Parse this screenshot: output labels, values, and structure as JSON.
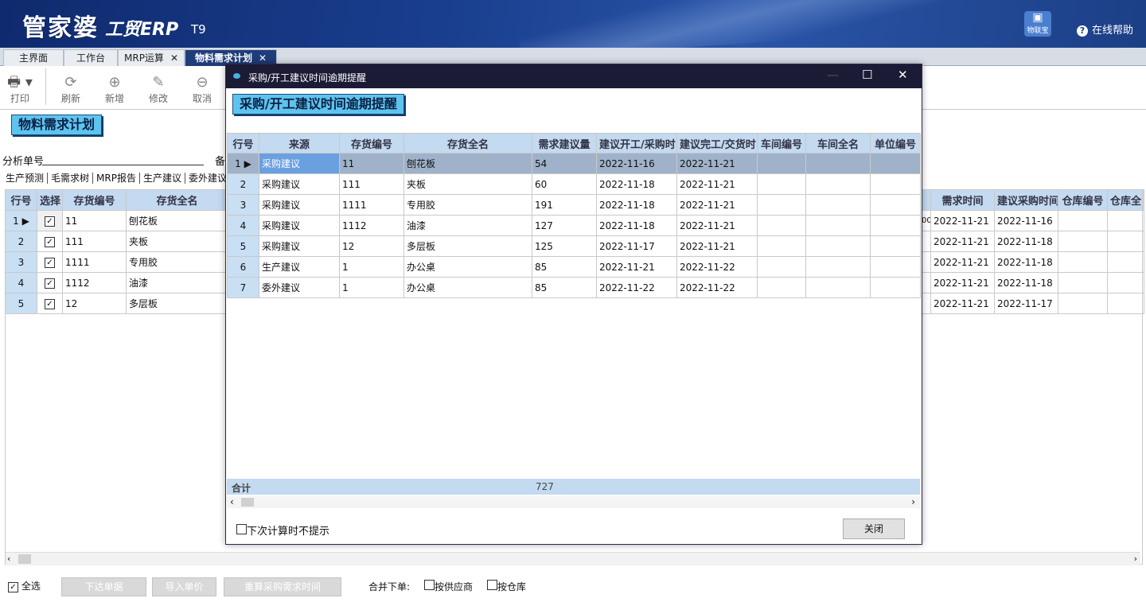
{
  "header": {
    "logo_text": "管家婆",
    "logo_sub": "工贸ERP",
    "logo_version": "T9",
    "iot_label": "物联宝",
    "help_label": "在线帮助"
  },
  "tabs": [
    {
      "label": "主界面"
    },
    {
      "label": "工作台"
    },
    {
      "label": "MRP运算"
    },
    {
      "label": "物料需求计划"
    }
  ],
  "toolbar": {
    "print": "打印",
    "refresh": "刷新",
    "add": "新增",
    "edit": "修改",
    "cancel": "取消"
  },
  "page": {
    "title": "物料需求计划",
    "analysis_label": "分析单号",
    "remark_label": "备",
    "subtabs": [
      "生产预测",
      "毛需求树",
      "MRP报告",
      "生产建议",
      "委外建议"
    ]
  },
  "main_grid": {
    "left_headers": [
      "行号",
      "选择",
      "存货编号",
      "存货全名"
    ],
    "right_headers": [
      "需求时间",
      "建议采购时间",
      "仓库编号",
      "仓库全"
    ],
    "rows": [
      {
        "no": "1",
        "code": "11",
        "name": "刨花板",
        "trail": "00",
        "need": "2022-11-21",
        "buy": "2022-11-16"
      },
      {
        "no": "2",
        "code": "111",
        "name": "夹板",
        "trail": "",
        "need": "2022-11-21",
        "buy": "2022-11-18"
      },
      {
        "no": "3",
        "code": "1111",
        "name": "专用胶",
        "trail": "",
        "need": "2022-11-21",
        "buy": "2022-11-18"
      },
      {
        "no": "4",
        "code": "1112",
        "name": "油漆",
        "trail": "",
        "need": "2022-11-21",
        "buy": "2022-11-18"
      },
      {
        "no": "5",
        "code": "12",
        "name": "多层板",
        "trail": "",
        "need": "2022-11-21",
        "buy": "2022-11-17"
      }
    ]
  },
  "bottom": {
    "select_all": "全选",
    "issue_btn": "下达单据",
    "import_price_btn": "导入单价",
    "recalc_btn": "重算采购需求时间",
    "merge_label": "合并下单:",
    "by_supplier": "按供应商",
    "by_warehouse": "按仓库"
  },
  "dialog": {
    "window_title": "采购/开工建议时间逾期提醒",
    "heading": "采购/开工建议时间逾期提醒",
    "headers": [
      "行号",
      "来源",
      "存货编号",
      "存货全名",
      "需求建议量",
      "建议开工/采购时",
      "建议完工/交货时",
      "车间编号",
      "车间全名",
      "单位编号"
    ],
    "rows": [
      {
        "no": "1",
        "source": "采购建议",
        "code": "11",
        "name": "刨花板",
        "qty": "54",
        "start": "2022-11-16",
        "end": "2022-11-21"
      },
      {
        "no": "2",
        "source": "采购建议",
        "code": "111",
        "name": "夹板",
        "qty": "60",
        "start": "2022-11-18",
        "end": "2022-11-21"
      },
      {
        "no": "3",
        "source": "采购建议",
        "code": "1111",
        "name": "专用胶",
        "qty": "191",
        "start": "2022-11-18",
        "end": "2022-11-21"
      },
      {
        "no": "4",
        "source": "采购建议",
        "code": "1112",
        "name": "油漆",
        "qty": "127",
        "start": "2022-11-18",
        "end": "2022-11-21"
      },
      {
        "no": "5",
        "source": "采购建议",
        "code": "12",
        "name": "多层板",
        "qty": "125",
        "start": "2022-11-17",
        "end": "2022-11-21"
      },
      {
        "no": "6",
        "source": "生产建议",
        "code": "1",
        "name": "办公桌",
        "qty": "85",
        "start": "2022-11-21",
        "end": "2022-11-22"
      },
      {
        "no": "7",
        "source": "委外建议",
        "code": "1",
        "name": "办公桌",
        "qty": "85",
        "start": "2022-11-22",
        "end": "2022-11-22"
      }
    ],
    "sum_label": "合计",
    "sum_qty": "727",
    "no_prompt_label": "下次计算时不提示",
    "close_btn": "关闭"
  }
}
